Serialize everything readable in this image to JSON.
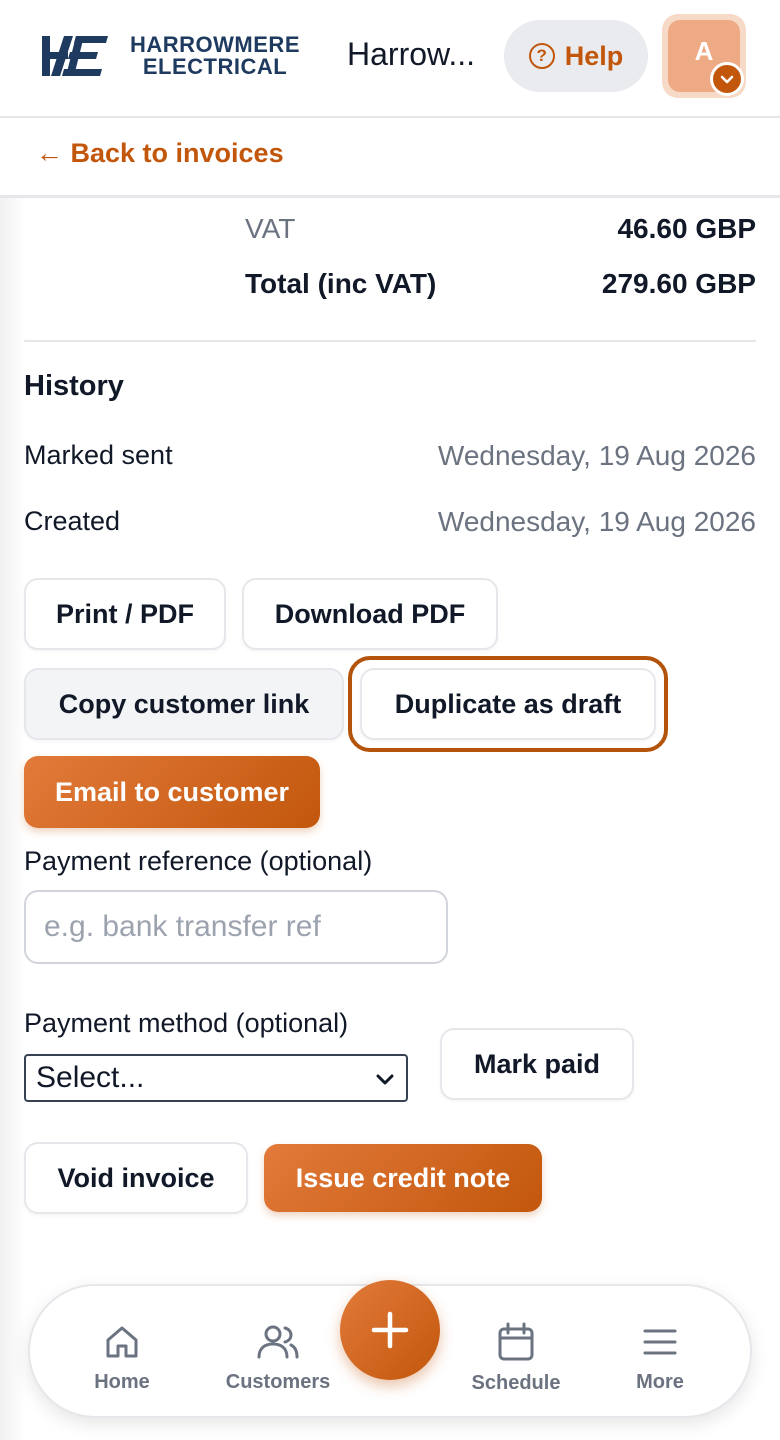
{
  "brand": {
    "logo_line1": "HARROWMERE",
    "logo_line2": "ELECTRICAL",
    "org_name": "Harrow...",
    "accent_color": "#c2570c",
    "navy_color": "#1e3a5f"
  },
  "header": {
    "help_label": "Help",
    "avatar_initial": "A"
  },
  "back_link": "← Back to invoices",
  "totals": {
    "vat_label": "VAT",
    "vat_value": "46.60 GBP",
    "total_label": "Total (inc VAT)",
    "total_value": "279.60 GBP"
  },
  "history": {
    "title": "History",
    "entries": [
      {
        "label": "Marked sent",
        "date": "Wednesday, 19 Aug 2026"
      },
      {
        "label": "Created",
        "date": "Wednesday, 19 Aug 2026"
      }
    ]
  },
  "actions": {
    "print_pdf": "Print / PDF",
    "download_pdf": "Download PDF",
    "copy_link": "Copy customer link",
    "duplicate": "Duplicate as draft",
    "email": "Email to customer",
    "mark_paid": "Mark paid",
    "void": "Void invoice",
    "credit_note": "Issue credit note"
  },
  "payment": {
    "reference_label": "Payment reference (optional)",
    "reference_placeholder": "e.g. bank transfer ref",
    "reference_value": "",
    "method_label": "Payment method (optional)",
    "method_selected": "Select..."
  },
  "bottom_nav": {
    "home": "Home",
    "customers": "Customers",
    "schedule": "Schedule",
    "more": "More"
  }
}
